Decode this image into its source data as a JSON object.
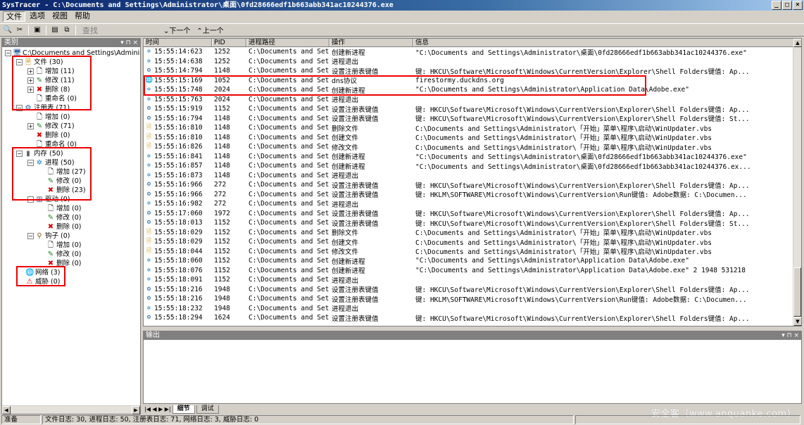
{
  "window": {
    "title": "SysTracer - C:\\Documents and Settings\\Administrator\\桌面\\0fd28666edf1b663abb341ac10244376.exe",
    "min": "_",
    "max": "□",
    "close": "×"
  },
  "menu": [
    "文件",
    "选项",
    "视图",
    "帮助"
  ],
  "toolbar": {
    "search_label": "查找",
    "next_label": "下一个",
    "prev_label": "上一个"
  },
  "left_pane": {
    "header": "类别",
    "header_buttons": "▾ ⊓ ×",
    "root": "C:\\Documents and Settings\\Administ",
    "nodes": [
      {
        "label": "文件 (30)"
      },
      {
        "label": "增加 (11)"
      },
      {
        "label": "修改 (11)"
      },
      {
        "label": "删除 (8)"
      },
      {
        "label": "重命名 (0)"
      },
      {
        "label": "注册表 (71)"
      },
      {
        "label": "增加 (0)"
      },
      {
        "label": "修改 (71)"
      },
      {
        "label": "删除 (0)"
      },
      {
        "label": "重命名 (0)"
      },
      {
        "label": "内存 (50)"
      },
      {
        "label": "进程 (50)"
      },
      {
        "label": "增加 (27)"
      },
      {
        "label": "修改 (0)"
      },
      {
        "label": "删除 (23)"
      },
      {
        "label": "驱动 (0)"
      },
      {
        "label": "增加 (0)"
      },
      {
        "label": "修改 (0)"
      },
      {
        "label": "删除 (0)"
      },
      {
        "label": "钩子 (0)"
      },
      {
        "label": "增加 (0)"
      },
      {
        "label": "修改 (0)"
      },
      {
        "label": "删除 (0)"
      },
      {
        "label": "网络 (3)"
      },
      {
        "label": "威胁 (0)"
      }
    ]
  },
  "log": {
    "columns": [
      "时间",
      "PID",
      "进程路径",
      "操作",
      "信息"
    ],
    "rows": [
      {
        "icon": "proc",
        "time": "15:55:14:623",
        "pid": "1252",
        "path": "C:\\Documents and Set...",
        "op": "创建新进程",
        "info": "\"C:\\Documents and Settings\\Administrator\\桌面\\0fd28666edf1b663abb341ac10244376.exe\""
      },
      {
        "icon": "proc",
        "time": "15:55:14:638",
        "pid": "1252",
        "path": "C:\\Documents and Set...",
        "op": "进程退出",
        "info": ""
      },
      {
        "icon": "reg",
        "time": "15:55:14:794",
        "pid": "1148",
        "path": "C:\\Documents and Set...",
        "op": "设置注册表键值",
        "info": "键: HKCU\\Software\\Microsoft\\Windows\\CurrentVersion\\Explorer\\Shell Folders键值: Ap..."
      },
      {
        "icon": "net",
        "time": "15:55:15:169",
        "pid": "1052",
        "path": "C:\\Documents and Set...",
        "op": "dns协议",
        "info": "firestormy.duckdns.org"
      },
      {
        "icon": "proc",
        "time": "15:55:15:748",
        "pid": "2024",
        "path": "C:\\Documents and Set...",
        "op": "创建新进程",
        "info": "\"C:\\Documents and Settings\\Administrator\\Application Data\\Adobe.exe\""
      },
      {
        "icon": "proc",
        "time": "15:55:15:763",
        "pid": "2024",
        "path": "C:\\Documents and Set...",
        "op": "进程退出",
        "info": ""
      },
      {
        "icon": "reg",
        "time": "15:55:15:919",
        "pid": "1152",
        "path": "C:\\Documents and Set...",
        "op": "设置注册表键值",
        "info": "键: HKCU\\Software\\Microsoft\\Windows\\CurrentVersion\\Explorer\\Shell Folders键值: Ap..."
      },
      {
        "icon": "reg",
        "time": "15:55:16:794",
        "pid": "1148",
        "path": "C:\\Documents and Set...",
        "op": "设置注册表键值",
        "info": "键: HKCU\\Software\\Microsoft\\Windows\\CurrentVersion\\Explorer\\Shell Folders键值: St..."
      },
      {
        "icon": "file",
        "time": "15:55:16:810",
        "pid": "1148",
        "path": "C:\\Documents and Set...",
        "op": "删除文件",
        "info": "C:\\Documents and Settings\\Administrator\\「开始」菜单\\程序\\启动\\WinUpdater.vbs"
      },
      {
        "icon": "file",
        "time": "15:55:16:810",
        "pid": "1148",
        "path": "C:\\Documents and Set...",
        "op": "创建文件",
        "info": "C:\\Documents and Settings\\Administrator\\「开始」菜单\\程序\\启动\\WinUpdater.vbs"
      },
      {
        "icon": "file",
        "time": "15:55:16:826",
        "pid": "1148",
        "path": "C:\\Documents and Set...",
        "op": "修改文件",
        "info": "C:\\Documents and Settings\\Administrator\\「开始」菜单\\程序\\启动\\WinUpdater.vbs"
      },
      {
        "icon": "proc",
        "time": "15:55:16:841",
        "pid": "1148",
        "path": "C:\\Documents and Set...",
        "op": "创建新进程",
        "info": "\"C:\\Documents and Settings\\Administrator\\桌面\\0fd28666edf1b663abb341ac10244376.exe\""
      },
      {
        "icon": "proc",
        "time": "15:55:16:857",
        "pid": "1148",
        "path": "C:\\Documents and Set...",
        "op": "创建新进程",
        "info": "\"C:\\Documents and Settings\\Administrator\\桌面\\0fd28666edf1b663abb341ac10244376.ex..."
      },
      {
        "icon": "proc",
        "time": "15:55:16:873",
        "pid": "1148",
        "path": "C:\\Documents and Set...",
        "op": "进程退出",
        "info": ""
      },
      {
        "icon": "reg",
        "time": "15:55:16:966",
        "pid": "272",
        "path": "C:\\Documents and Set...",
        "op": "设置注册表键值",
        "info": "键: HKCU\\Software\\Microsoft\\Windows\\CurrentVersion\\Explorer\\Shell Folders键值: Ap..."
      },
      {
        "icon": "reg",
        "time": "15:55:16:966",
        "pid": "272",
        "path": "C:\\Documents and Set...",
        "op": "设置注册表键值",
        "info": "键: HKLM\\SOFTWARE\\Microsoft\\Windows\\CurrentVersion\\Run键值: Adobe数据: C:\\Documen..."
      },
      {
        "icon": "proc",
        "time": "15:55:16:982",
        "pid": "272",
        "path": "C:\\Documents and Set...",
        "op": "进程退出",
        "info": ""
      },
      {
        "icon": "reg",
        "time": "15:55:17:060",
        "pid": "1972",
        "path": "C:\\Documents and Set...",
        "op": "设置注册表键值",
        "info": "键: HKCU\\Software\\Microsoft\\Windows\\CurrentVersion\\Explorer\\Shell Folders键值: Ap..."
      },
      {
        "icon": "reg",
        "time": "15:55:18:013",
        "pid": "1152",
        "path": "C:\\Documents and Set...",
        "op": "设置注册表键值",
        "info": "键: HKCU\\Software\\Microsoft\\Windows\\CurrentVersion\\Explorer\\Shell Folders键值: St..."
      },
      {
        "icon": "file",
        "time": "15:55:18:029",
        "pid": "1152",
        "path": "C:\\Documents and Set...",
        "op": "删除文件",
        "info": "C:\\Documents and Settings\\Administrator\\「开始」菜单\\程序\\启动\\WinUpdater.vbs"
      },
      {
        "icon": "file",
        "time": "15:55:18:029",
        "pid": "1152",
        "path": "C:\\Documents and Set...",
        "op": "创建文件",
        "info": "C:\\Documents and Settings\\Administrator\\「开始」菜单\\程序\\启动\\WinUpdater.vbs"
      },
      {
        "icon": "file",
        "time": "15:55:18:044",
        "pid": "1152",
        "path": "C:\\Documents and Set...",
        "op": "修改文件",
        "info": "C:\\Documents and Settings\\Administrator\\「开始」菜单\\程序\\启动\\WinUpdater.vbs"
      },
      {
        "icon": "proc",
        "time": "15:55:18:060",
        "pid": "1152",
        "path": "C:\\Documents and Set...",
        "op": "创建新进程",
        "info": "\"C:\\Documents and Settings\\Administrator\\Application Data\\Adobe.exe\""
      },
      {
        "icon": "proc",
        "time": "15:55:18:076",
        "pid": "1152",
        "path": "C:\\Documents and Set...",
        "op": "创建新进程",
        "info": "\"C:\\Documents and Settings\\Administrator\\Application Data\\Adobe.exe\" 2 1948 531218"
      },
      {
        "icon": "proc",
        "time": "15:55:18:091",
        "pid": "1152",
        "path": "C:\\Documents and Set...",
        "op": "进程退出",
        "info": ""
      },
      {
        "icon": "reg",
        "time": "15:55:18:216",
        "pid": "1948",
        "path": "C:\\Documents and Set...",
        "op": "设置注册表键值",
        "info": "键: HKCU\\Software\\Microsoft\\Windows\\CurrentVersion\\Explorer\\Shell Folders键值: Ap..."
      },
      {
        "icon": "reg",
        "time": "15:55:18:216",
        "pid": "1948",
        "path": "C:\\Documents and Set...",
        "op": "设置注册表键值",
        "info": "键: HKLM\\SOFTWARE\\Microsoft\\Windows\\CurrentVersion\\Run键值: Adobe数据: C:\\Documen..."
      },
      {
        "icon": "proc",
        "time": "15:55:18:232",
        "pid": "1948",
        "path": "C:\\Documents and Set...",
        "op": "进程退出",
        "info": ""
      },
      {
        "icon": "reg",
        "time": "15:55:18:294",
        "pid": "1624",
        "path": "C:\\Documents and Set...",
        "op": "设置注册表键值",
        "info": "键: HKCU\\Software\\Microsoft\\Windows\\CurrentVersion\\Explorer\\Shell Folders键值: Ap..."
      }
    ]
  },
  "output_pane": {
    "header": "输出",
    "header_buttons": "▾ ⊓ ×"
  },
  "bottom_tabs": [
    "细节",
    "调试"
  ],
  "watermark": "安全客（www.anquanke.com）",
  "status": {
    "left": "准备",
    "counts": "文件日志: 30, 进程日志: 50, 注册表日志: 71, 网络日志: 3, 威胁日志: 0"
  },
  "colors": {
    "title_start": "#0a246a",
    "highlight": "#e00000"
  }
}
